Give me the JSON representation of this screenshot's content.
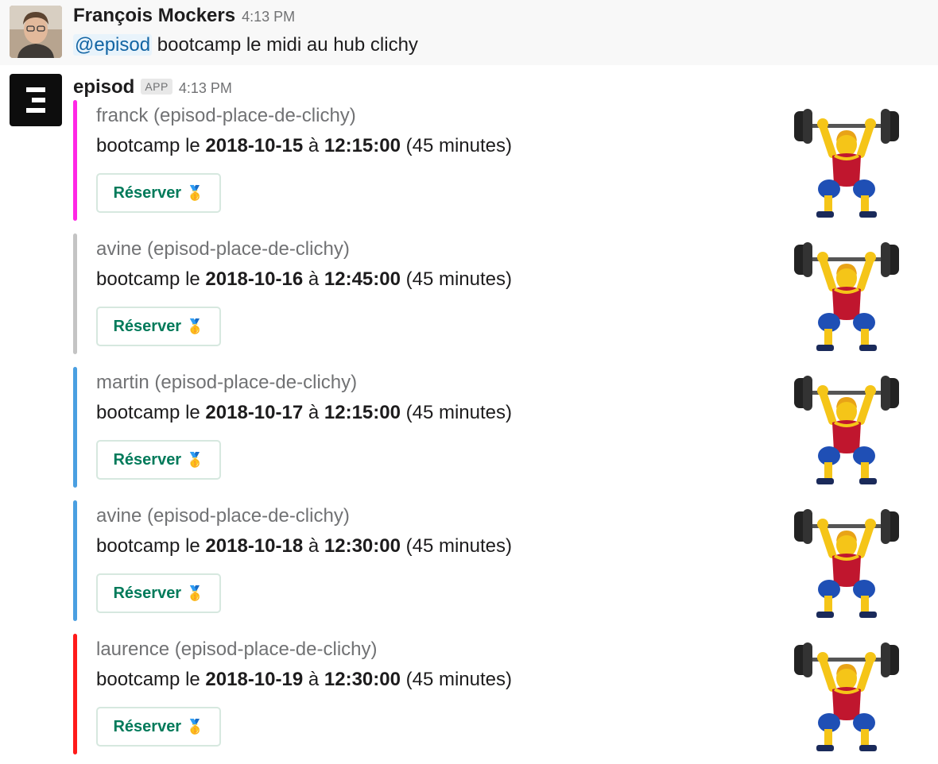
{
  "user_message": {
    "author": "François Mockers",
    "time": "4:13 PM",
    "mention": "@episod",
    "text": " bootcamp le midi au hub clichy"
  },
  "bot_message": {
    "author": "episod",
    "badge": "APP",
    "time": "4:13 PM",
    "attachments": [
      {
        "color": "#ff27e5",
        "author": "franck (episod-place-de-clichy)",
        "prefix": "bootcamp le ",
        "date": "2018-10-15",
        "sep": " à ",
        "time": "12:15:00",
        "suffix": " (45 minutes)",
        "button": "Réserver",
        "button_icon": "sports-medal-icon",
        "thumb": "person-lifting-weights-icon"
      },
      {
        "color": "#c4c4c4",
        "author": "avine (episod-place-de-clichy)",
        "prefix": "bootcamp le ",
        "date": "2018-10-16",
        "sep": " à ",
        "time": "12:45:00",
        "suffix": " (45 minutes)",
        "button": "Réserver",
        "button_icon": "sports-medal-icon",
        "thumb": "person-lifting-weights-icon"
      },
      {
        "color": "#4a9fe1",
        "author": "martin (episod-place-de-clichy)",
        "prefix": "bootcamp le ",
        "date": "2018-10-17",
        "sep": " à ",
        "time": "12:15:00",
        "suffix": " (45 minutes)",
        "button": "Réserver",
        "button_icon": "sports-medal-icon",
        "thumb": "person-lifting-weights-icon"
      },
      {
        "color": "#4a9fe1",
        "author": "avine (episod-place-de-clichy)",
        "prefix": "bootcamp le ",
        "date": "2018-10-18",
        "sep": " à ",
        "time": "12:30:00",
        "suffix": " (45 minutes)",
        "button": "Réserver",
        "button_icon": "sports-medal-icon",
        "thumb": "person-lifting-weights-icon"
      },
      {
        "color": "#ff1a1a",
        "author": "laurence (episod-place-de-clichy)",
        "prefix": "bootcamp le ",
        "date": "2018-10-19",
        "sep": " à ",
        "time": "12:30:00",
        "suffix": " (45 minutes)",
        "button": "Réserver",
        "button_icon": "sports-medal-icon",
        "thumb": "person-lifting-weights-icon"
      }
    ]
  }
}
